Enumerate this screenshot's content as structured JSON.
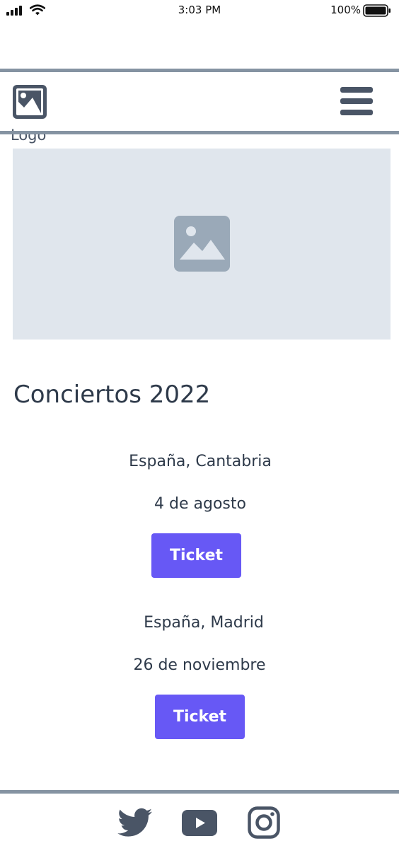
{
  "status_bar": {
    "time": "3:03 PM",
    "battery": "100%"
  },
  "header": {
    "logo_label": "Logo",
    "logo_icon": "image-icon",
    "menu_icon": "hamburger-menu-icon"
  },
  "hero": {
    "icon": "image-placeholder-icon"
  },
  "main": {
    "title": "Conciertos 2022",
    "events": [
      {
        "location": "España, Cantabria",
        "date": "4 de agosto",
        "button_label": "Ticket"
      },
      {
        "location": "España, Madrid",
        "date": "26 de noviembre",
        "button_label": "Ticket"
      }
    ]
  },
  "footer": {
    "social_icons": [
      "twitter-icon",
      "youtube-icon",
      "instagram-icon"
    ]
  },
  "colors": {
    "accent": "#6758f5",
    "text": "#2e3a4a",
    "divider": "#8593a2",
    "placeholder_bg": "#e0e6ed",
    "icon": "#4a5566"
  }
}
